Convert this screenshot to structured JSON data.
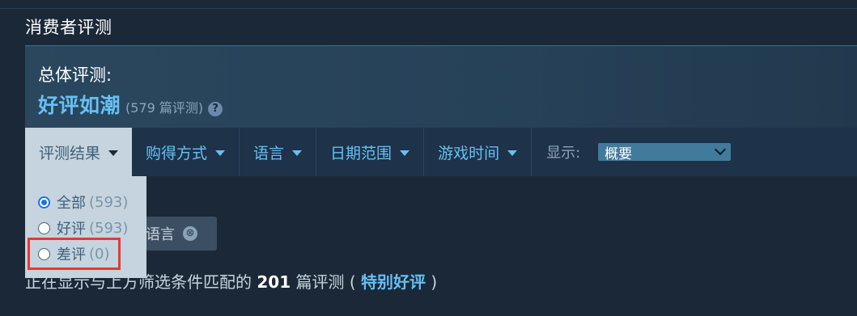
{
  "section_title": "消费者评测",
  "summary": {
    "label": "总体评测:",
    "rating": "好评如潮",
    "count": "(579 篇评测)",
    "help_icon": "?"
  },
  "filters": {
    "items": [
      {
        "label": "评测结果"
      },
      {
        "label": "购得方式"
      },
      {
        "label": "语言"
      },
      {
        "label": "日期范围"
      },
      {
        "label": "游戏时间"
      }
    ],
    "display_label": "显示:",
    "display_value": "概要"
  },
  "dropdown": {
    "options": [
      {
        "label": "全部",
        "count": "(593)",
        "selected": true
      },
      {
        "label": "好评",
        "count": "(593)",
        "selected": false
      },
      {
        "label": "差评",
        "count": "(0)",
        "selected": false
      }
    ]
  },
  "language_chip": {
    "text": "的语言",
    "close_icon": "⊗"
  },
  "results": {
    "prefix": "正在显示与上方筛选条件匹配的 ",
    "count": "201",
    "middle": " 篇评测 ( ",
    "rating": "特别好评",
    "suffix": " )"
  },
  "colors": {
    "accent": "#66c0f4",
    "background": "#1b2838",
    "highlight": "#e53935"
  }
}
